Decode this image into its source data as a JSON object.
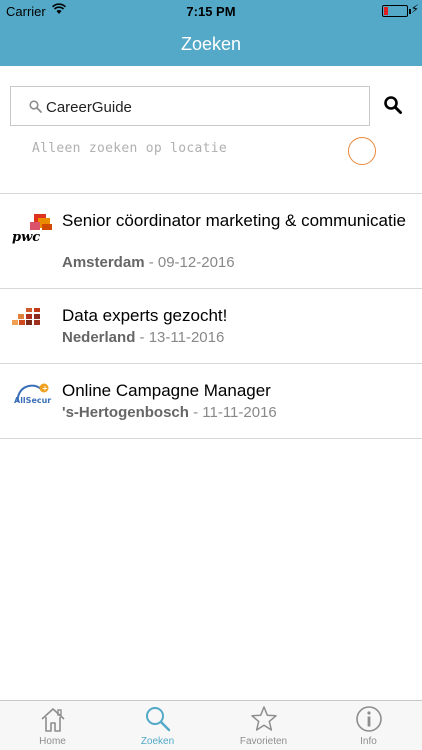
{
  "status_bar": {
    "carrier": "Carrier",
    "time": "7:15 PM",
    "battery_color": "#e02020"
  },
  "nav": {
    "title": "Zoeken",
    "background_color": "#53a9c7"
  },
  "search": {
    "value": "CareerGuide",
    "location_toggle_label": "Alleen zoeken op locatie",
    "location_toggle_on": false,
    "toggle_color": "#e9893a"
  },
  "results": [
    {
      "logo": "pwc-logo",
      "title": "Senior cöordinator marketing & communicatie",
      "location": "Amsterdam",
      "separator": " - ",
      "date": "09-12-2016"
    },
    {
      "logo": "data-experts-logo",
      "title": "Data experts gezocht!",
      "location": "Nederland",
      "separator": " - ",
      "date": "13-11-2016"
    },
    {
      "logo": "allsecur-logo",
      "title": "Online Campagne Manager",
      "location": "'s-Hertogenbosch",
      "separator": " - ",
      "date": "11-11-2016"
    }
  ],
  "tabs": [
    {
      "label": "Home",
      "icon": "home-icon",
      "active": false
    },
    {
      "label": "Zoeken",
      "icon": "search-icon",
      "active": true
    },
    {
      "label": "Favorieten",
      "icon": "star-icon",
      "active": false
    },
    {
      "label": "Info",
      "icon": "info-icon",
      "active": false
    }
  ],
  "colors": {
    "accent": "#53a9c7",
    "tab_inactive": "#8e8e8e"
  },
  "logo_texts": {
    "pwc": "pwc",
    "allsecur": "AllSecur"
  }
}
